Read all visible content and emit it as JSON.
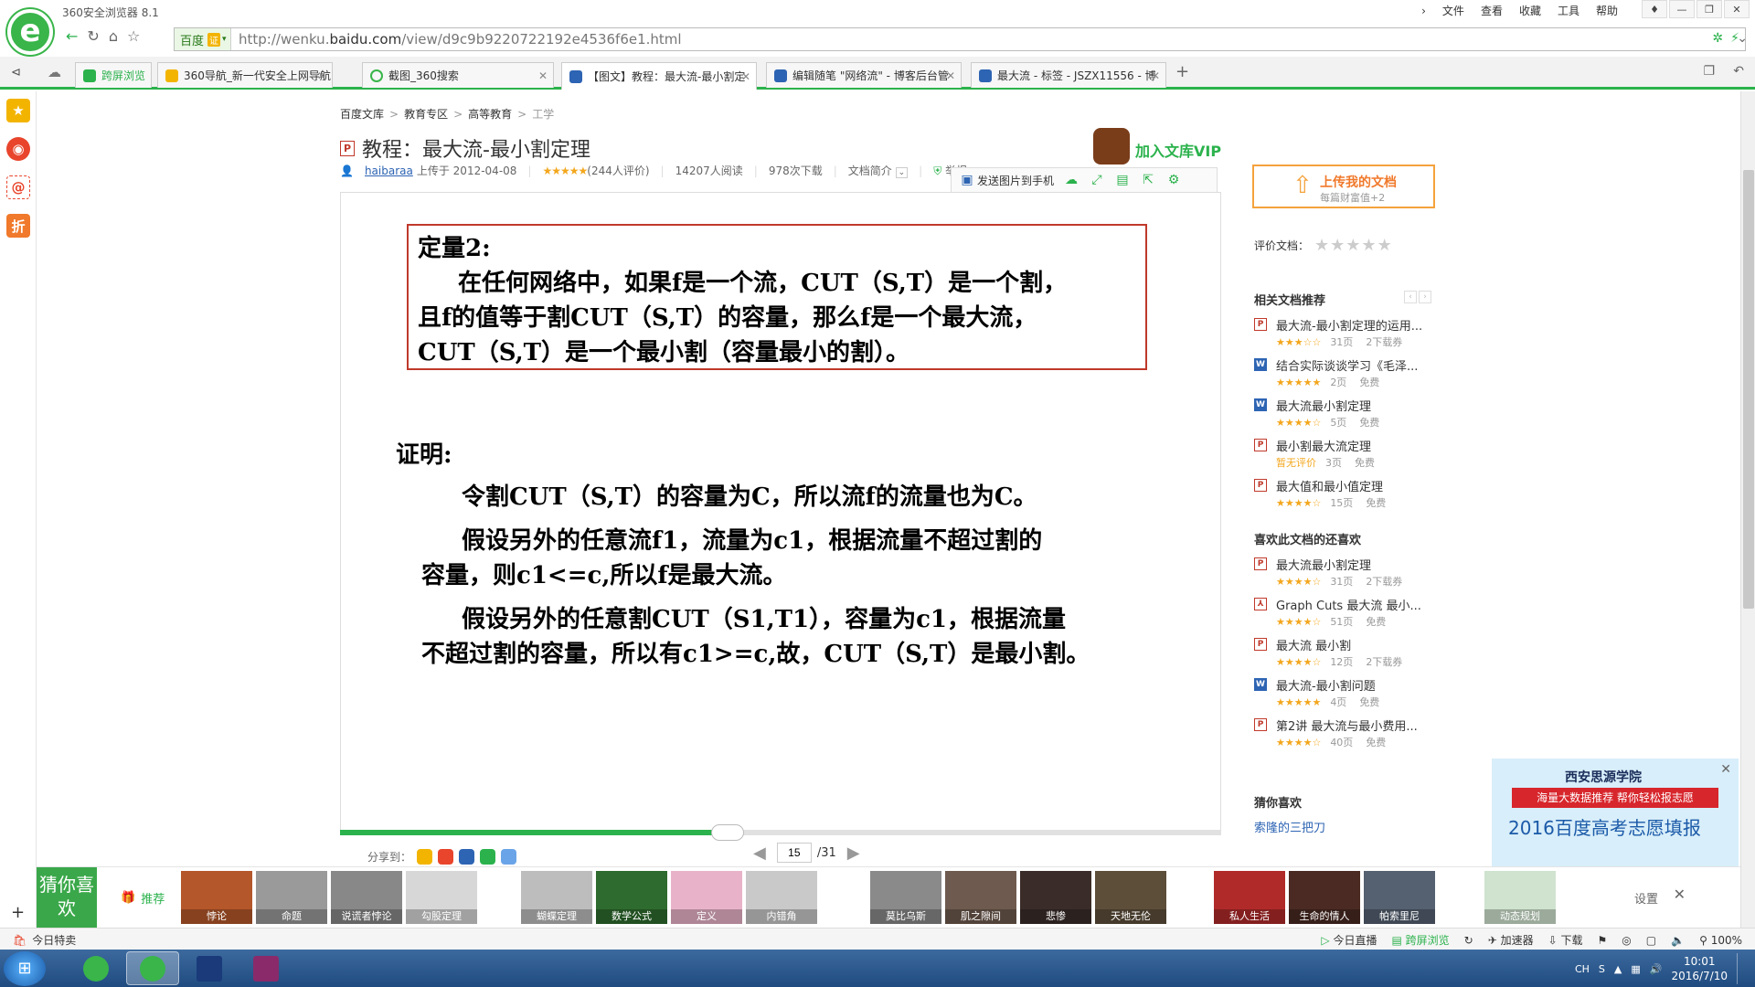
{
  "browser": {
    "title": "360安全浏览器 8.1",
    "menu": [
      "文件",
      "查看",
      "收藏",
      "工具",
      "帮助"
    ],
    "engine_label": "百度",
    "engine_badge": "证",
    "url_prefix": "http://wenku.",
    "url_domain": "baidu.com",
    "url_rest": "/view/d9c9b9220722192e4536f6e1.html"
  },
  "tabs": [
    {
      "label": "跨屏浏览",
      "color": "#2bb24c"
    },
    {
      "label": "360导航_新一代安全上网导航",
      "color": "#f3b400"
    },
    {
      "label": "截图_360搜索",
      "color": "#39b54a"
    },
    {
      "label": "【图文】教程：最大流-最小割定",
      "color": "#2d64b3"
    },
    {
      "label": "编辑随笔 \"网络流\" - 博客后台管",
      "color": "#2d64b3"
    },
    {
      "label": "最大流 - 标签 - JSZX11556 - 博",
      "color": "#2d64b3"
    }
  ],
  "breadcrumb": [
    "百度文库",
    "教育专区",
    "高等教育",
    "工学"
  ],
  "doc": {
    "type_icon": "P",
    "title": "教程：最大流-最小割定理",
    "author": "haibaraa",
    "uploaded": "上传于 2012-04-08",
    "stars": "★★★★★",
    "ratings": "(244人评价)",
    "reads": "14207人阅读",
    "downloads": "978次下载",
    "intro": "文档简介",
    "report": "举报"
  },
  "vip": {
    "label": "加入文库VIP"
  },
  "toolbar": {
    "send_label": "发送图片到手机"
  },
  "slide": {
    "box_lines": [
      "定量2:",
      "在任何网络中，如果f是一个流，CUT（S,T）是一个割，",
      "且f的值等于割CUT（S,T）的容量，那么f是一个最大流，",
      "CUT（S,T）是一个最小割（容量最小的割）。"
    ],
    "proof_title": "证明:",
    "proof_lines": [
      "令割CUT（S,T）的容量为C，所以流f的流量也为C。",
      "假设另外的任意流f1，流量为c1，根据流量不超过割的",
      "容量，则c1<=c,所以f是最大流。",
      "假设另外的任意割CUT（S1,T1），容量为c1，根据流量",
      "不超过割的容量，所以有c1>=c,故，CUT（S,T）是最小割。"
    ]
  },
  "reading_progress": 0.44,
  "share_label": "分享到：",
  "pager": {
    "current": "15",
    "total": "/31"
  },
  "upload": {
    "title": "上传我的文档",
    "subtitle": "每篇财富值+2"
  },
  "rating_label": "评价文档：",
  "related": {
    "heading": "相关文档推荐",
    "items": [
      {
        "icon": "P",
        "name": "最大流-最小割定理的运用...",
        "stars": "★★★☆☆",
        "pages": "31页",
        "price": "2下载券"
      },
      {
        "icon": "W",
        "name": "结合实际谈谈学习《毛泽...",
        "stars": "★★★★★",
        "pages": "2页",
        "price": "免费"
      },
      {
        "icon": "W",
        "name": "最大流最小割定理",
        "stars": "★★★★☆",
        "pages": "5页",
        "price": "免费"
      },
      {
        "icon": "P",
        "name": "最小割最大流定理",
        "stars": "暂无评价",
        "pages": "3页",
        "price": "免费"
      },
      {
        "icon": "P",
        "name": "最大值和最小值定理",
        "stars": "★★★★☆",
        "pages": "15页",
        "price": "免费"
      }
    ]
  },
  "also_liked": {
    "heading": "喜欢此文档的还喜欢",
    "items": [
      {
        "icon": "P",
        "name": "最大流最小割定理",
        "stars": "★★★★☆",
        "pages": "31页",
        "price": "2下载券"
      },
      {
        "icon": "pdf",
        "name": "Graph Cuts 最大流 最小...",
        "stars": "★★★★☆",
        "pages": "51页",
        "price": "免费"
      },
      {
        "icon": "P",
        "name": "最大流 最小割",
        "stars": "★★★★☆",
        "pages": "12页",
        "price": "2下载券"
      },
      {
        "icon": "W",
        "name": "最大流-最小割问题",
        "stars": "★★★★★",
        "pages": "4页",
        "price": "免费"
      },
      {
        "icon": "P",
        "name": "第2讲 最大流与最小费用...",
        "stars": "★★★★☆",
        "pages": "40页",
        "price": "免费"
      }
    ]
  },
  "guess": {
    "heading": "猜你喜欢",
    "link": "索隆的三把刀"
  },
  "ad": {
    "school": "西安思源学院",
    "banner": "海量大数据推荐 帮你轻松报志愿",
    "headline": "2016百度高考志愿填报"
  },
  "strip": {
    "label": "猜你喜欢",
    "rec_label": "推荐",
    "settings": "设置",
    "thumbs": [
      {
        "cap": "悖论",
        "color": "#b4572a"
      },
      {
        "cap": "命题",
        "color": "#9a9a9a"
      },
      {
        "cap": "说谎者悖论",
        "color": "#888888"
      },
      {
        "cap": "勾股定理",
        "color": "#d7d7d7"
      },
      {
        "cap": "蝴蝶定理",
        "color": "#bdbdbd"
      },
      {
        "cap": "数学公式",
        "color": "#2e6b2e"
      },
      {
        "cap": "定义",
        "color": "#e8b3c9"
      },
      {
        "cap": "内错角",
        "color": "#c9c9c9"
      },
      {
        "cap": "莫比乌斯",
        "color": "#8a8a8a"
      },
      {
        "cap": "肌之隙间",
        "color": "#6e5a4e"
      },
      {
        "cap": "悲惨",
        "color": "#3a2c28"
      },
      {
        "cap": "天地无伦",
        "color": "#5d4e3a"
      },
      {
        "cap": "私人生活",
        "color": "#b02a2a"
      },
      {
        "cap": "生命的情人",
        "color": "#4a2a22"
      },
      {
        "cap": "帕索里尼",
        "color": "#556070"
      },
      {
        "cap": "动态规划",
        "color": "#cfe3cf"
      }
    ]
  },
  "status": {
    "left": "今日特卖",
    "right": [
      "今日直播",
      "跨屏浏览",
      "加速器",
      "下载",
      "100%"
    ]
  },
  "clock": {
    "time": "10:01",
    "date": "2016/7/10",
    "lang": "CH"
  }
}
